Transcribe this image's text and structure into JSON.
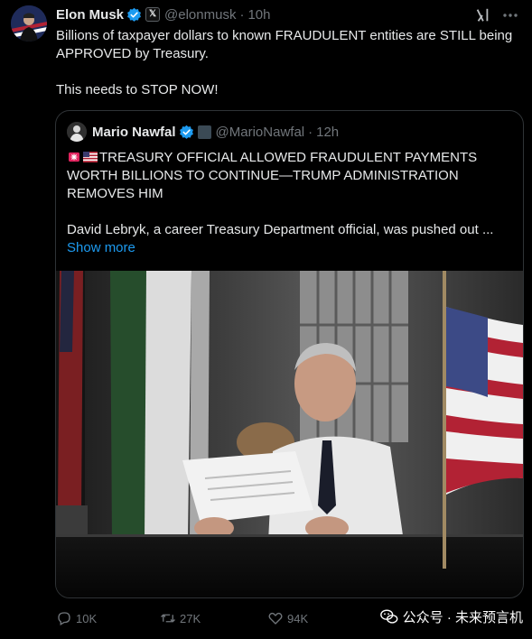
{
  "tweet": {
    "author_name": "Elon Musk",
    "handle": "@elonmusk",
    "time": "10h",
    "text_line1": "Billions of taxpayer dollars to known FRAUDULENT entities are STILL being APPROVED by Treasury.",
    "text_line2": "This needs to STOP NOW!"
  },
  "quote": {
    "author_name": "Mario Nawfal",
    "handle": "@MarioNawfal",
    "time": "12h",
    "headline": "TREASURY OFFICIAL ALLOWED FRAUDULENT PAYMENTS WORTH BILLIONS TO CONTINUE—TRUMP ADMINISTRATION REMOVES HIM",
    "body": "David Lebryk, a career Treasury Department official, was pushed out ...",
    "show_more": "Show more"
  },
  "actions": {
    "replies": "10K",
    "retweets": "27K",
    "likes": "94K"
  },
  "watermark": {
    "text": "公众号 · 未来预言机"
  },
  "colors": {
    "background": "#000000",
    "text": "#e7e9ea",
    "muted": "#71767b",
    "accent": "#1d9bf0",
    "border": "#2f3336"
  },
  "icons": [
    "verified-badge-icon",
    "x-affiliation-icon",
    "grok-icon",
    "more-icon",
    "siren-icon",
    "us-flag-icon",
    "reply-icon",
    "retweet-icon",
    "like-icon",
    "wechat-icon"
  ]
}
